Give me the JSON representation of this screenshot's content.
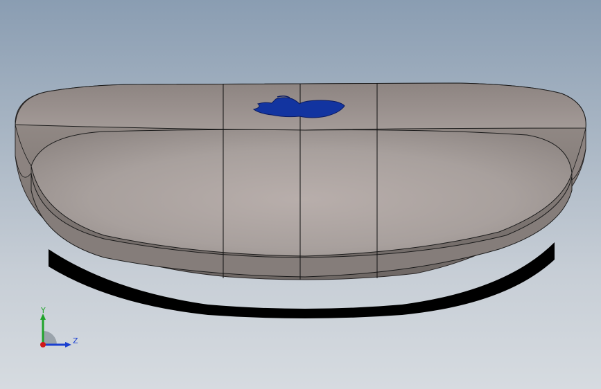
{
  "viewport": {
    "background_top": "#8a9db2",
    "background_bottom": "#d6dbe0"
  },
  "model": {
    "name": "glasses-case",
    "body_color": "#a59b97",
    "edge_color": "#1a1a1a",
    "shadow_color": "#000000",
    "logo_color": "#1234a0",
    "logo_icon": "apple-logo-icon"
  },
  "triad": {
    "y_label": "Y",
    "z_label": "Z",
    "y_color": "#1fa32a",
    "z_color": "#1a3fd0",
    "x_color": "#d01818"
  }
}
